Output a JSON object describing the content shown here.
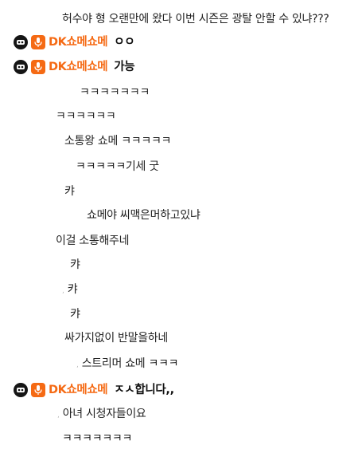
{
  "streamer_nickname": "DK쇼메쇼메",
  "messages": [
    {
      "text": "허수야 형 오랜만에 왔다 이번 시즌은 광탈 안할 수 있냐???"
    },
    {
      "text": "ㅇㅇ"
    },
    {
      "text": "가능"
    },
    {
      "text": "ㅋㅋㅋㅋㅋㅋㅋ"
    },
    {
      "text": "ㅋㅋㅋㅋㅋㅋ"
    },
    {
      "text": "소통왕 쇼메 ㅋㅋㅋㅋㅋ"
    },
    {
      "text": "ㅋㅋㅋㅋㅋ기세 굿"
    },
    {
      "text": "캬"
    },
    {
      "text": "쇼메야 씨맥은머하고있냐"
    },
    {
      "text": "이걸 소통해주네"
    },
    {
      "text": "캬"
    },
    {
      "text": "캬"
    },
    {
      "text": "캬"
    },
    {
      "text": "싸가지없이 반말을하네"
    },
    {
      "text": "스트리머 쇼메 ㅋㅋㅋ"
    },
    {
      "text": "ㅈㅅ합니다,,"
    },
    {
      "text": "아녀 시청자들이요"
    },
    {
      "text": "ㅋㅋㅋㅋㅋㅋㅋ"
    }
  ],
  "colors": {
    "nickname": "#f56a14",
    "badge_background": "#f56a14",
    "avatar_background": "#151515",
    "viewer_text": "#222222",
    "streamer_text": "#111111"
  },
  "icons": {
    "avatar": "robot-avatar-icon",
    "badge": "microphone-icon"
  }
}
